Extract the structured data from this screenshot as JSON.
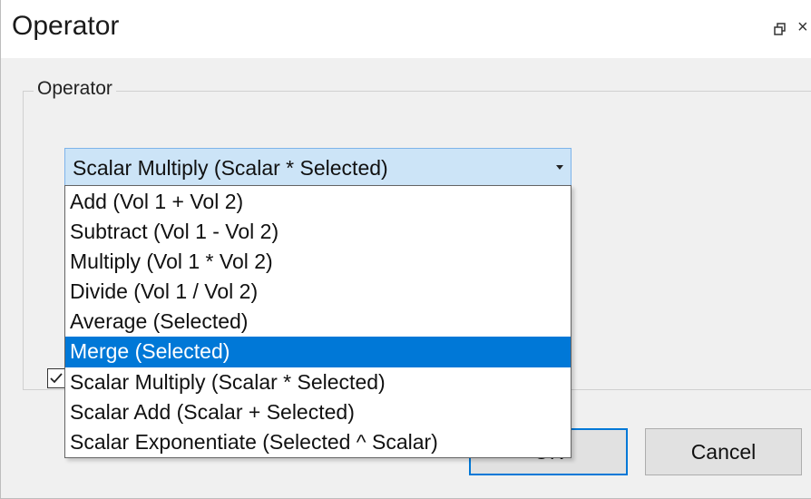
{
  "window": {
    "title": "Operator",
    "restore_icon": "restore-icon",
    "close_icon": "close-icon",
    "close_glyph": "×"
  },
  "operator_group": {
    "label": "Operator",
    "combo": {
      "selected_value": "Scalar Multiply (Scalar * Selected)",
      "expanded": true,
      "highlighted_option": "Merge (Selected)",
      "options": [
        "Add (Vol 1 + Vol 2)",
        "Subtract (Vol 1 - Vol 2)",
        "Multiply (Vol 1 * Vol 2)",
        "Divide (Vol 1 / Vol 2)",
        "Average (Selected)",
        "Merge (Selected)",
        "Scalar Multiply (Scalar * Selected)",
        "Scalar Add (Scalar + Selected)",
        "Scalar Exponentiate (Selected ^ Scalar)"
      ]
    },
    "checkbox": {
      "checked": true
    }
  },
  "buttons": {
    "ok_label": "OK",
    "cancel_label": "Cancel"
  },
  "colors": {
    "highlight": "#0078d7",
    "combo_focus_bg": "#cce4f7",
    "combo_focus_border": "#7eb4ea",
    "window_bg": "#f0f0f0"
  }
}
